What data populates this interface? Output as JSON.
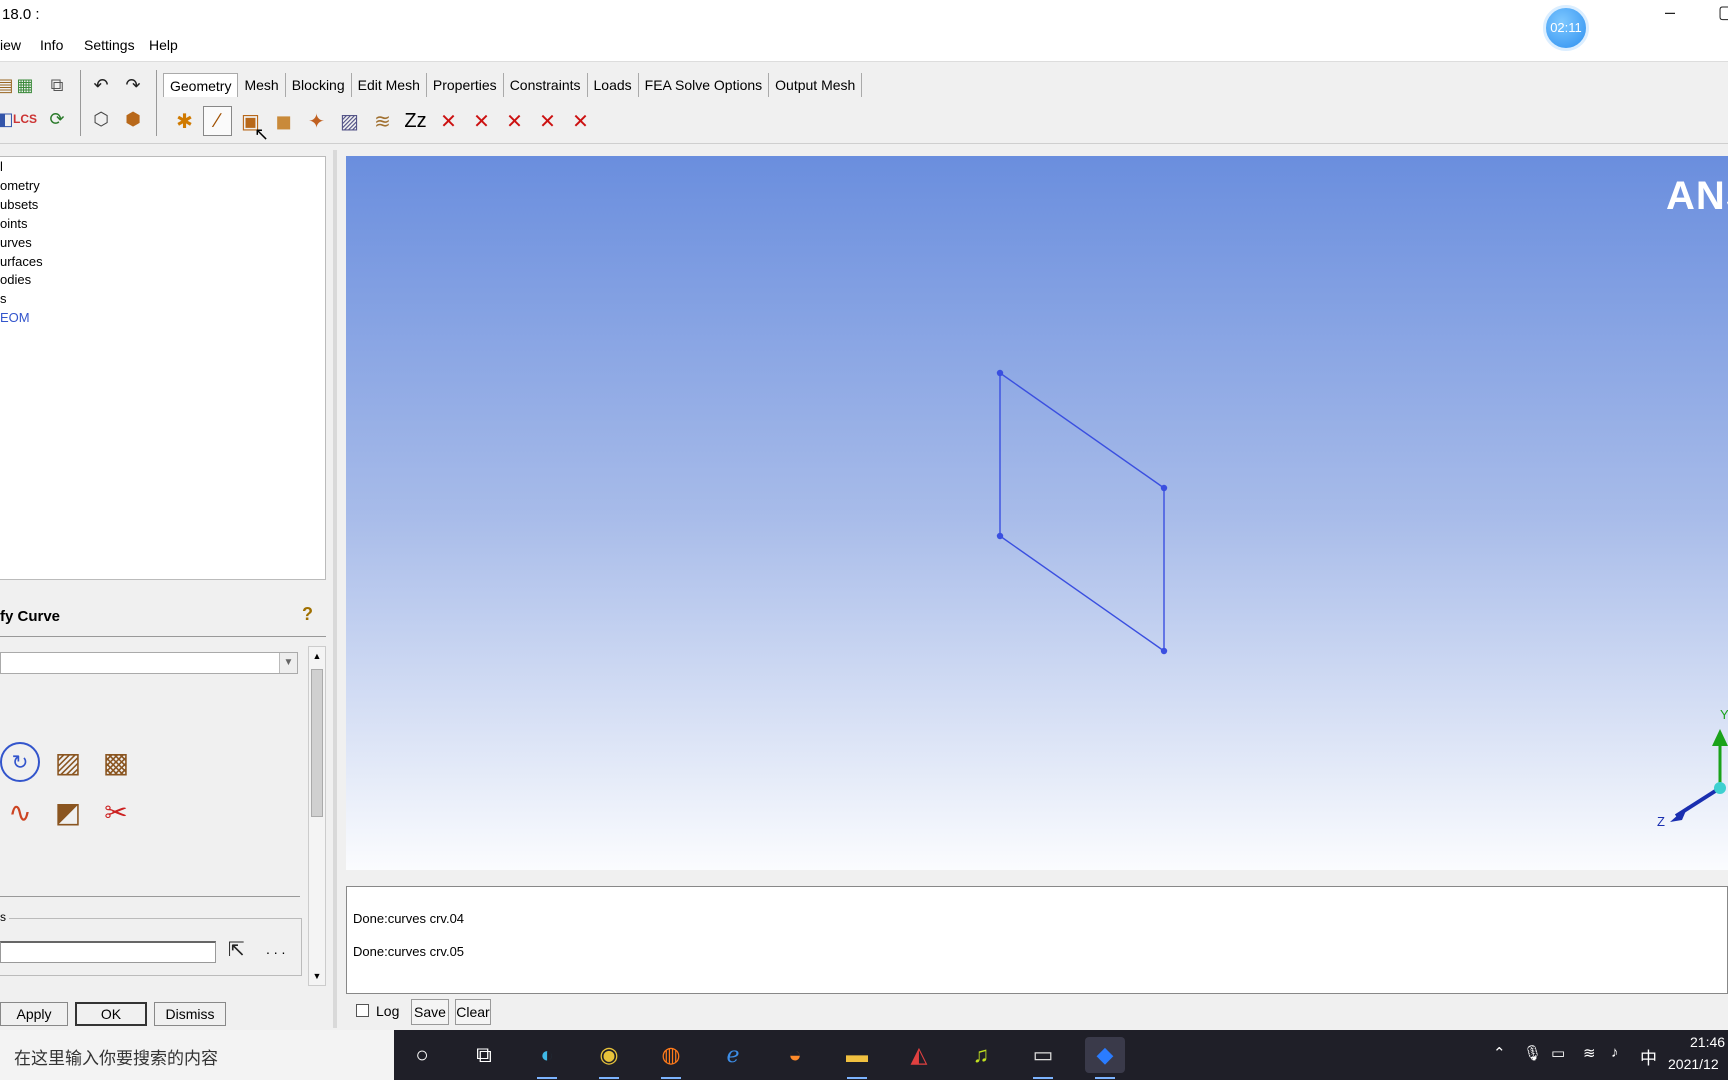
{
  "window": {
    "title": "18.0 :"
  },
  "timer": "02:11",
  "window_controls": {
    "minimize": "–"
  },
  "menu": {
    "items": [
      "iew",
      "Info",
      "Settings",
      "Help"
    ]
  },
  "tabs": [
    "Geometry",
    "Mesh",
    "Blocking",
    "Edit Mesh",
    "Properties",
    "Constraints",
    "Loads",
    "FEA Solve Options",
    "Output Mesh"
  ],
  "active_tab": "Geometry",
  "geometry_tools": [
    {
      "name": "create-point-icon",
      "glyph": "✱",
      "color": "#d07a00"
    },
    {
      "name": "create-curve-icon",
      "glyph": "∕",
      "color": "#a05000"
    },
    {
      "name": "create-surface-icon",
      "glyph": "▣",
      "color": "#b8681a"
    },
    {
      "name": "create-body-icon",
      "glyph": "◼",
      "color": "#c98a3a"
    },
    {
      "name": "create-faceted-icon",
      "glyph": "✦",
      "color": "#c06020"
    },
    {
      "name": "repair-geometry-icon",
      "glyph": "▨",
      "color": "#555588"
    },
    {
      "name": "transform-geometry-icon",
      "glyph": "≋",
      "color": "#a07030"
    },
    {
      "name": "restore-dormant-icon",
      "glyph": "Zz",
      "color": "#000000"
    },
    {
      "name": "delete-point-icon",
      "glyph": "✕",
      "color": "#cc1111"
    },
    {
      "name": "delete-curve-icon",
      "glyph": "✕",
      "color": "#cc1111"
    },
    {
      "name": "delete-surface-icon",
      "glyph": "✕",
      "color": "#cc1111"
    },
    {
      "name": "delete-body-icon",
      "glyph": "✕",
      "color": "#cc1111"
    },
    {
      "name": "delete-any-icon",
      "glyph": "✕",
      "color": "#cc1111"
    }
  ],
  "tree": {
    "items": [
      "l",
      "ometry",
      "ubsets",
      "oints",
      "urves",
      "urfaces",
      "odies",
      "s",
      "EOM"
    ]
  },
  "panel": {
    "title": "fy Curve",
    "fieldset_label": "s",
    "dots": ". . .",
    "buttons": {
      "apply": "Apply",
      "ok": "OK",
      "dismiss": "Dismiss"
    }
  },
  "viewport": {
    "logo": "ANS",
    "triad": {
      "y": "Y",
      "z": "Z"
    },
    "colors": {
      "geometry": "#3a4fe0"
    }
  },
  "messages": [
    "Done:curves crv.04",
    "Done:curves crv.05"
  ],
  "logbar": {
    "log": "Log",
    "save": "Save",
    "clear": "Clear"
  },
  "taskbar": {
    "search_placeholder": "在这里输入你要搜索的内容",
    "ime": "中",
    "time": "21:46",
    "date": "2021/12"
  }
}
